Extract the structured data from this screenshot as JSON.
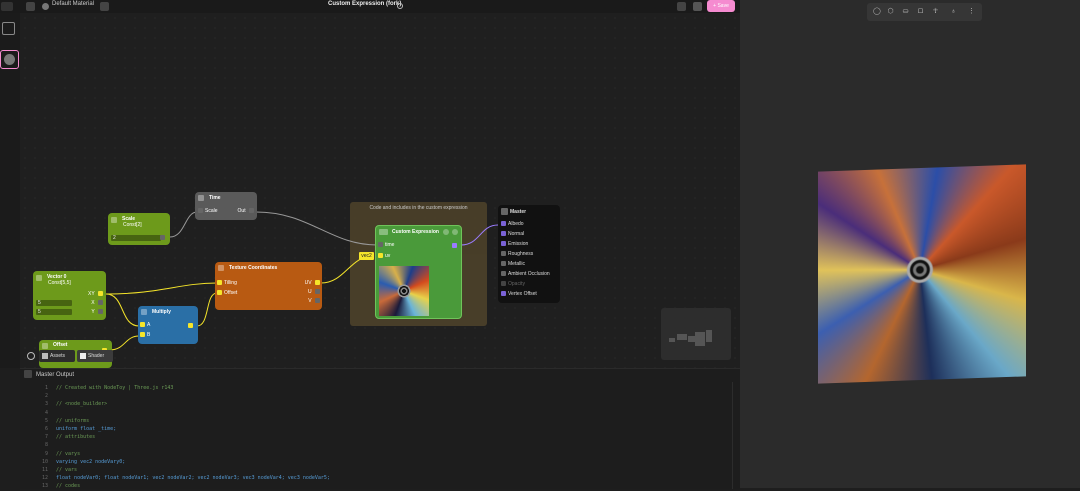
{
  "topbar": {
    "material_name": "Default Material",
    "title": "Custom Expression (fork)",
    "save_label": "+ Save"
  },
  "nodes": {
    "time": {
      "title": "Time",
      "input_label": "Scale",
      "output_label": "Out"
    },
    "scale": {
      "title": "Scale",
      "subtitle": "Const[2]",
      "value": "2"
    },
    "vector": {
      "title": "Vector 0",
      "subtitle": "Const[5,5]",
      "out_xy": "XY",
      "out_x": "X",
      "out_y": "Y",
      "value_x": "5",
      "value_y": "5"
    },
    "multiply": {
      "title": "Multiply",
      "in_a": "A",
      "in_b": "B"
    },
    "texcoord": {
      "title": "Texture Coordinates",
      "in_tilling": "Tilling",
      "in_offset": "Offset",
      "out_uv": "UV",
      "out_u": "U",
      "out_v": "V"
    },
    "offset": {
      "title": "Offset"
    },
    "group": {
      "title": "Code and includes in the custom expression"
    },
    "custom": {
      "title": "Custom Expression",
      "in_time": "time",
      "in_uv": "uv",
      "uv_tag": "vec2"
    },
    "master": {
      "title": "Master",
      "inputs": [
        "Albedo",
        "Normal",
        "Emission",
        "Roughness",
        "Metallic",
        "Ambient Occlusion",
        "Opacity",
        "Vertex Offset"
      ]
    }
  },
  "tabs": {
    "assets": "Assets",
    "shader": "Shader"
  },
  "bottom": {
    "title": "Master Output",
    "code_lines": [
      {
        "n": "1",
        "t": "// Created with NodeToy | Three.js r143",
        "k": "comment"
      },
      {
        "n": "2",
        "t": "",
        "k": "plain"
      },
      {
        "n": "3",
        "t": "// <node_builder>",
        "k": "comment"
      },
      {
        "n": "4",
        "t": "",
        "k": "plain"
      },
      {
        "n": "5",
        "t": "// uniforms",
        "k": "comment"
      },
      {
        "n": "6",
        "t": "uniform float _time;",
        "k": "kw"
      },
      {
        "n": "7",
        "t": "// attributes",
        "k": "comment"
      },
      {
        "n": "8",
        "t": "",
        "k": "plain"
      },
      {
        "n": "9",
        "t": "// varys",
        "k": "comment"
      },
      {
        "n": "10",
        "t": "varying vec2 nodeVary0;",
        "k": "kw"
      },
      {
        "n": "11",
        "t": "// vars",
        "k": "comment"
      },
      {
        "n": "12",
        "t": "float nodeVar0; float nodeVar1; vec2 nodeVar2; vec2 nodeVar3; vec3 nodeVar4; vec3 nodeVar5;",
        "k": "kw"
      },
      {
        "n": "13",
        "t": "// codes",
        "k": "comment"
      }
    ]
  },
  "colors": {
    "accent_pink": "#f58bd0",
    "time_node": "#5a5a5a",
    "scale_node": "#6d9a1b",
    "multiply_node": "#2a6fa6",
    "texcoord_node": "#b85a12",
    "custom_node": "#4a9a3a",
    "master_node": "#111111"
  }
}
